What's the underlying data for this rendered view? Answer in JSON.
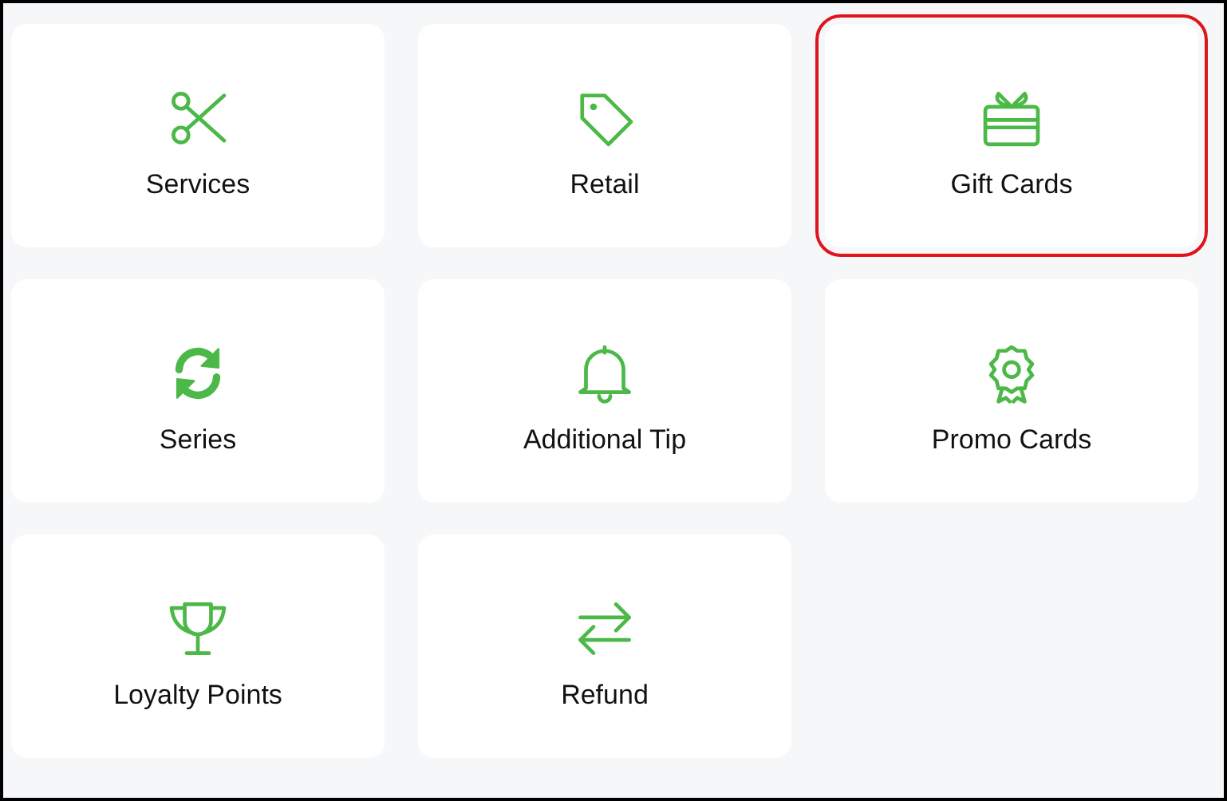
{
  "tiles": [
    {
      "label": "Services",
      "kind": "scissors",
      "selected": false
    },
    {
      "label": "Retail",
      "kind": "tag",
      "selected": false
    },
    {
      "label": "Gift Cards",
      "kind": "gift",
      "selected": true
    },
    {
      "label": "Series",
      "kind": "refresh",
      "selected": false
    },
    {
      "label": "Additional Tip",
      "kind": "bell",
      "selected": false
    },
    {
      "label": "Promo Cards",
      "kind": "rosette",
      "selected": false
    },
    {
      "label": "Loyalty Points",
      "kind": "trophy",
      "selected": false
    },
    {
      "label": "Refund",
      "kind": "swap",
      "selected": false
    }
  ]
}
